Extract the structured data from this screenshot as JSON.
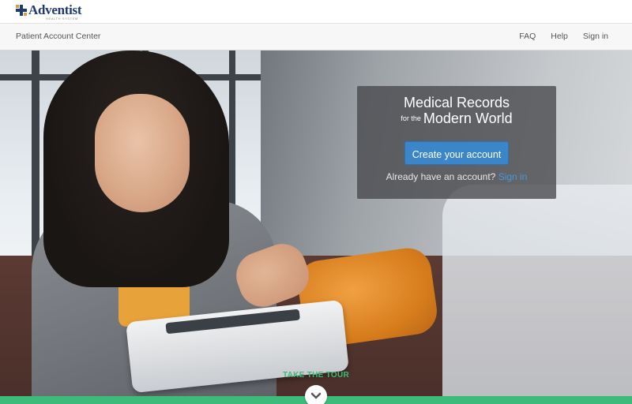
{
  "logo": {
    "name": "Adventist",
    "subtitle": "HEALTH SYSTEM"
  },
  "navbar": {
    "brand": "Patient Account Center",
    "links": [
      "FAQ",
      "Help",
      "Sign in"
    ]
  },
  "hero": {
    "headline_line1": "Medical Records",
    "headline_small": "for the",
    "headline_line2": "Modern World",
    "create_button": "Create your account",
    "already_text": "Already have an account?",
    "signin_link": "Sign in"
  },
  "tour": {
    "label": "TAKE THE TOUR",
    "icon": "chevron-down-icon"
  },
  "colors": {
    "accent_blue": "#3b86c9",
    "tour_green": "#3dbb7a",
    "logo_navy": "#1f3a6e"
  }
}
